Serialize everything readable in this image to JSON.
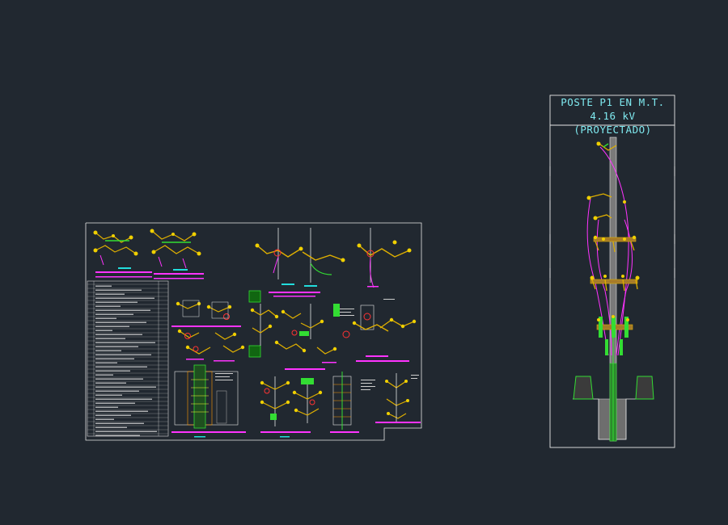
{
  "pole_detail": {
    "title_line1": "POSTE P1 EN M.T. 4.16 kV",
    "title_line2": "(PROYECTADO)"
  },
  "colors": {
    "background": "#212830",
    "frame": "#e8e8e8",
    "title_text": "#7fe9ef",
    "label_magenta": "#ff33ff",
    "insulator_yellow": "#f0d000",
    "conductor_green": "#33dd33",
    "concrete_gray": "#9a9a9a"
  }
}
